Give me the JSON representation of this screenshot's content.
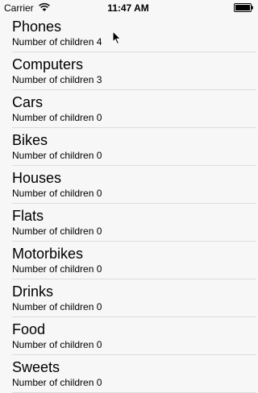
{
  "status_bar": {
    "carrier": "Carrier",
    "time": "11:47 AM",
    "wifi_icon": "wifi-icon",
    "battery_icon": "battery-icon"
  },
  "list": {
    "items": [
      {
        "title": "Phones",
        "subtitle": "Number of children 4"
      },
      {
        "title": "Computers",
        "subtitle": "Number of children 3"
      },
      {
        "title": "Cars",
        "subtitle": "Number of children 0"
      },
      {
        "title": "Bikes",
        "subtitle": "Number of children 0"
      },
      {
        "title": "Houses",
        "subtitle": "Number of children 0"
      },
      {
        "title": "Flats",
        "subtitle": "Number of children 0"
      },
      {
        "title": "Motorbikes",
        "subtitle": "Number of children 0"
      },
      {
        "title": "Drinks",
        "subtitle": "Number of children 0"
      },
      {
        "title": "Food",
        "subtitle": "Number of children 0"
      },
      {
        "title": "Sweets",
        "subtitle": "Number of children 0"
      }
    ]
  },
  "colors": {
    "background": "#f7f7f7",
    "separator": "#dcdcdc",
    "text": "#000000"
  }
}
